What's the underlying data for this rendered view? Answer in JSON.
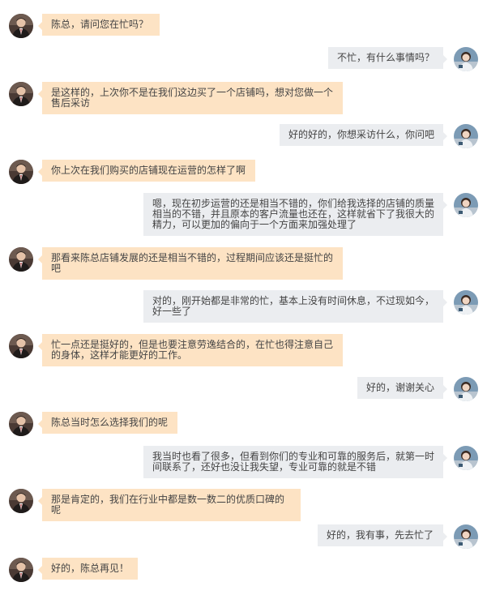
{
  "avatars": {
    "left": {
      "icon": "man-in-suit-avatar-icon",
      "bg": "#3a2a26"
    },
    "right": {
      "icon": "woman-portrait-avatar-icon",
      "bg": "#5b7f9d"
    }
  },
  "colors": {
    "left_bubble": "#fde3c4",
    "right_bubble": "#ebedf0"
  },
  "messages": [
    {
      "side": "left",
      "text": "陈总，请问您在忙吗？"
    },
    {
      "side": "right",
      "text": "不忙，有什么事情吗？"
    },
    {
      "side": "left",
      "text": "是这样的，上次你不是在我们这边买了一个店铺吗，想对您做一个售后采访"
    },
    {
      "side": "right",
      "text": "好的好的，你想采访什么，你问吧"
    },
    {
      "side": "left",
      "text": "你上次在我们购买的店铺现在运营的怎样了啊"
    },
    {
      "side": "right",
      "text": "嗯，现在初步运营的还是相当不错的，你们给我选择的店铺的质量相当的不错，并且原本的客户流量也还在，这样就省下了我很大的精力，可以更加的偏向于一个方面来加强处理了"
    },
    {
      "side": "left",
      "text": "那看来陈总店铺发展的还是相当不错的，过程期间应该还是挺忙的吧"
    },
    {
      "side": "right",
      "text": "对的，刚开始都是非常的忙，基本上没有时间休息，不过现如今，好一些了"
    },
    {
      "side": "left",
      "text": "忙一点还是挺好的，但是也要注意劳逸结合的，在忙也得注意自己的身体，这样才能更好的工作。"
    },
    {
      "side": "right",
      "text": "好的，谢谢关心"
    },
    {
      "side": "left",
      "text": "陈总当时怎么选择我们的呢"
    },
    {
      "side": "right",
      "text": "我当时也看了很多，但看到你们的专业和可靠的服务后，就第一时间联系了，还好也没让我失望，专业可靠的就是不错"
    },
    {
      "side": "left",
      "text": "那是肯定的，我们在行业中都是数一数二的优质口碑的呢"
    },
    {
      "side": "right",
      "text": "好的，我有事，先去忙了"
    },
    {
      "side": "left",
      "text": "好的，陈总再见！"
    }
  ]
}
